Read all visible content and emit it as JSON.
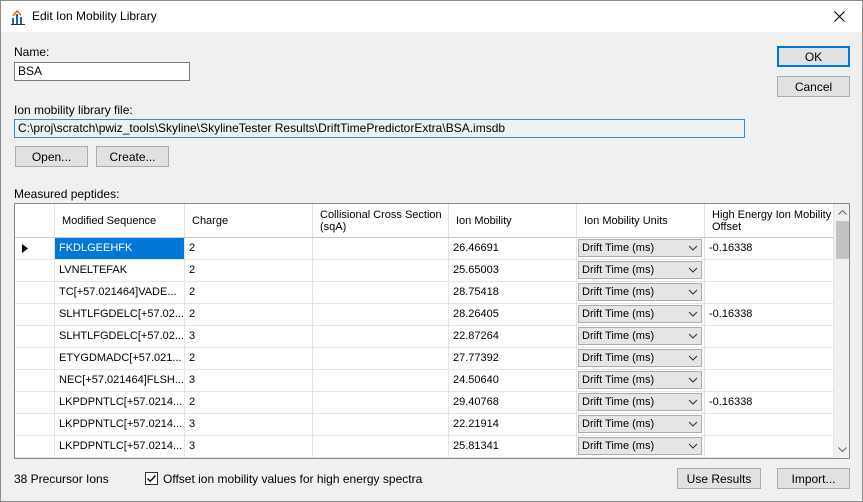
{
  "window": {
    "title": "Edit Ion Mobility Library",
    "icon": "ion-mobility-app-icon",
    "close_icon": "close-icon"
  },
  "name_field": {
    "label": "Name:",
    "value": "BSA"
  },
  "library_file": {
    "label": "Ion mobility library file:",
    "value": "C:\\proj\\scratch\\pwiz_tools\\Skyline\\SkylineTester Results\\DriftTimePredictorExtra\\BSA.imsdb"
  },
  "buttons": {
    "ok": "OK",
    "cancel": "Cancel",
    "open": "Open...",
    "create": "Create...",
    "use_results": "Use Results",
    "import": "Import..."
  },
  "measured_label": "Measured peptides:",
  "table": {
    "headers": {
      "sequence": "Modified Sequence",
      "charge": "Charge",
      "ccs": "Collisional Cross Section (sqA)",
      "mobility": "Ion Mobility",
      "units": "Ion Mobility Units",
      "offset": "High Energy Ion Mobility Offset"
    },
    "rows": [
      {
        "sequence": "FKDLGEEHFK",
        "charge": "2",
        "ccs": "",
        "mobility": "26.46691",
        "units": "Drift Time (ms)",
        "offset": "-0.16338",
        "current": true
      },
      {
        "sequence": "LVNELTEFAK",
        "charge": "2",
        "ccs": "",
        "mobility": "25.65003",
        "units": "Drift Time (ms)",
        "offset": ""
      },
      {
        "sequence": "TC[+57.021464]VADE...",
        "charge": "2",
        "ccs": "",
        "mobility": "28.75418",
        "units": "Drift Time (ms)",
        "offset": ""
      },
      {
        "sequence": "SLHTLFGDELC[+57.02...",
        "charge": "2",
        "ccs": "",
        "mobility": "28.26405",
        "units": "Drift Time (ms)",
        "offset": "-0.16338"
      },
      {
        "sequence": "SLHTLFGDELC[+57.02...",
        "charge": "3",
        "ccs": "",
        "mobility": "22.87264",
        "units": "Drift Time (ms)",
        "offset": ""
      },
      {
        "sequence": "ETYGDMADC[+57.021...",
        "charge": "2",
        "ccs": "",
        "mobility": "27.77392",
        "units": "Drift Time (ms)",
        "offset": ""
      },
      {
        "sequence": "NEC[+57.021464]FLSH...",
        "charge": "3",
        "ccs": "",
        "mobility": "24.50640",
        "units": "Drift Time (ms)",
        "offset": ""
      },
      {
        "sequence": "LKPDPNTLC[+57.0214...",
        "charge": "2",
        "ccs": "",
        "mobility": "29.40768",
        "units": "Drift Time (ms)",
        "offset": "-0.16338"
      },
      {
        "sequence": "LKPDPNTLC[+57.0214...",
        "charge": "3",
        "ccs": "",
        "mobility": "22.21914",
        "units": "Drift Time (ms)",
        "offset": ""
      },
      {
        "sequence": "LKPDPNTLC[+57.0214...",
        "charge": "3",
        "ccs": "",
        "mobility": "25.81341",
        "units": "Drift Time (ms)",
        "offset": ""
      }
    ]
  },
  "status": {
    "precursor_count": "38 Precursor Ions"
  },
  "offset_checkbox": {
    "label": "Offset ion mobility values for high energy spectra",
    "checked": true
  },
  "colors": {
    "selection": "#0078d7",
    "default_button_border": "#0078d7"
  }
}
